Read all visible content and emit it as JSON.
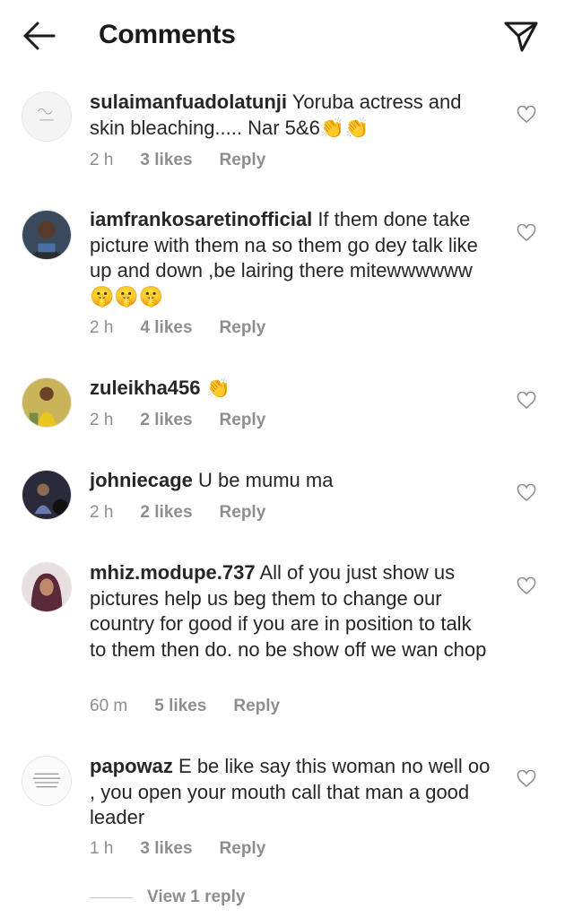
{
  "header": {
    "title": "Comments",
    "back_icon": "arrow-left-icon",
    "share_icon": "paper-plane-icon"
  },
  "comments": [
    {
      "username": "sulaimanfuadolatunji",
      "text": "Yoruba actress and skin bleaching..... Nar 5&6👏👏",
      "time": "2 h",
      "likes": "3 likes",
      "reply": "Reply"
    },
    {
      "username": "iamfrankosaretinofficial",
      "text": "If them done take picture with them na so them go dey talk like up and down ,be lairing there mitewwwwww 🤫🤫🤫",
      "time": "2 h",
      "likes": "4 likes",
      "reply": "Reply"
    },
    {
      "username": "zuleikha456",
      "text": "👏",
      "time": "2 h",
      "likes": "2 likes",
      "reply": "Reply"
    },
    {
      "username": "johniecage",
      "text": "U be mumu ma",
      "time": "2 h",
      "likes": "2 likes",
      "reply": "Reply"
    },
    {
      "username": "mhiz.modupe.737",
      "text": "All of you just show us pictures help us beg them to change our country for good if you are in position to talk to them then do. no be show off we wan chop",
      "time": "60 m",
      "likes": "5 likes",
      "reply": "Reply"
    },
    {
      "username": "papowaz",
      "text": "E be like say this woman no well oo , you open your mouth call that man a good leader",
      "time": "1 h",
      "likes": "3 likes",
      "reply": "Reply"
    }
  ],
  "view_replies": "View 1 reply",
  "colors": {
    "text": "#262626",
    "meta": "#8e8e8e",
    "divider": "#c7c7c7"
  }
}
